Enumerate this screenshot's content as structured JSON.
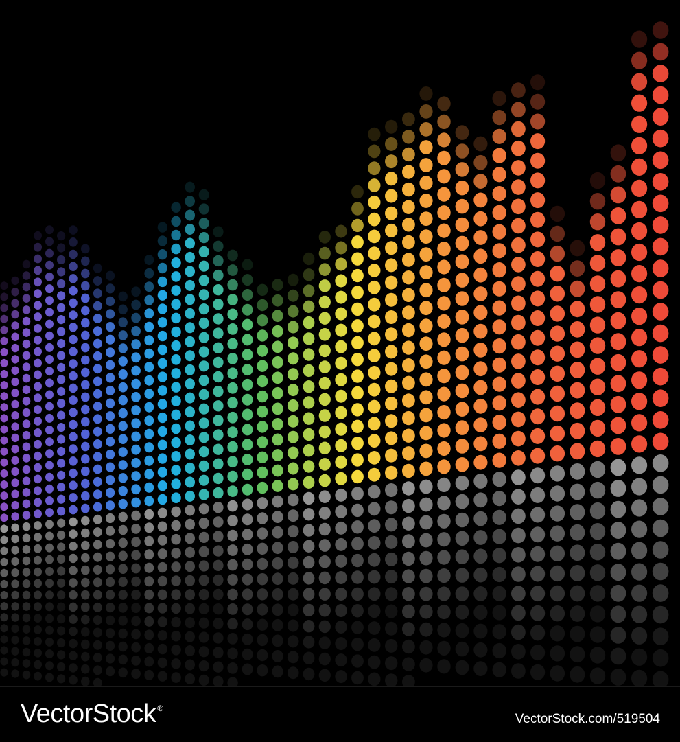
{
  "artwork": {
    "description_free": true,
    "colors": {
      "background": "#000000",
      "purple": "#8a4fc0",
      "blue": "#3f6fd6",
      "cyan": "#18b4e6",
      "green": "#5cc060",
      "yellow": "#f2d93a",
      "orange": "#f08a3a",
      "red": "#ef4a3a",
      "reflection": "#9a9a9a"
    }
  },
  "footer": {
    "logo_text": "VectorStock",
    "logo_mark": "®",
    "image_id": "VectorStock.com/519504"
  }
}
